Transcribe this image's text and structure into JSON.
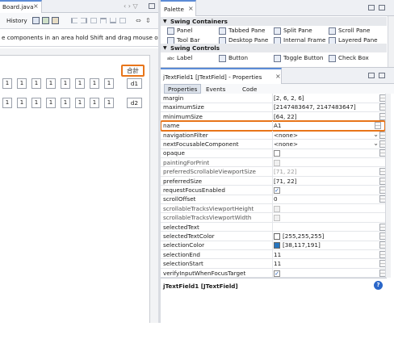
{
  "editor": {
    "tab_title": "Board.java",
    "tab_close": "×",
    "history_label": "History",
    "nav_arrows": "‹ › ▽",
    "hint_text": "e components in an area hold Shift and drag mouse over the",
    "sum_label": "合計",
    "row1_cells": [
      "1",
      "1",
      "1",
      "1",
      "1",
      "1",
      "1",
      "1"
    ],
    "row2_cells": [
      "1",
      "1",
      "1",
      "1",
      "1",
      "1",
      "1",
      "1"
    ],
    "row1_field": "d1",
    "row2_field": "d2"
  },
  "palette": {
    "title": "Palette",
    "close": "×",
    "groups": [
      {
        "name": "Swing Containers",
        "items": [
          "Panel",
          "Tabbed Pane",
          "Split Pane",
          "Scroll Pane",
          "Tool Bar",
          "Desktop Pane",
          "Internal Frame",
          "Layered Pane"
        ]
      },
      {
        "name": "Swing Controls",
        "items": [
          "Label",
          "Button",
          "Toggle Button",
          "Check Box"
        ]
      }
    ],
    "label_icon_text": "abc"
  },
  "properties": {
    "title": "jTextField1 [JTextField] - Properties",
    "close": "×",
    "tabs": [
      "Properties",
      "Events",
      "Code"
    ],
    "rows": [
      {
        "name": "margin",
        "value": "[2, 6, 2, 6]",
        "kind": "text",
        "dots": true
      },
      {
        "name": "maximumSize",
        "value": "[2147483647, 2147483647]",
        "kind": "text",
        "dots": true
      },
      {
        "name": "minimumSize",
        "value": "[64, 22]",
        "kind": "text",
        "dots": true
      },
      {
        "name": "name",
        "value": "A1",
        "kind": "text",
        "dots": true,
        "highlight": true
      },
      {
        "name": "navigationFilter",
        "value": "<none>",
        "kind": "dropdown",
        "dots": true
      },
      {
        "name": "nextFocusableComponent",
        "value": "<none>",
        "kind": "dropdown",
        "dots": true
      },
      {
        "name": "opaque",
        "value": "",
        "kind": "checkbox",
        "checked": false,
        "dots": true
      },
      {
        "name": "paintingForPrint",
        "value": "",
        "kind": "checkbox",
        "checked": false,
        "dim": true,
        "dots": false
      },
      {
        "name": "preferredScrollableViewportSize",
        "value": "[71, 22]",
        "kind": "text",
        "dim": true,
        "dots": true
      },
      {
        "name": "preferredSize",
        "value": "[71, 22]",
        "kind": "text",
        "dots": true
      },
      {
        "name": "requestFocusEnabled",
        "value": "",
        "kind": "checkbox",
        "checked": true,
        "dots": true
      },
      {
        "name": "scrollOffset",
        "value": "0",
        "kind": "text",
        "dots": true
      },
      {
        "name": "scrollableTracksViewportHeight",
        "value": "",
        "kind": "checkbox",
        "checked": false,
        "dim": true,
        "dots": false
      },
      {
        "name": "scrollableTracksViewportWidth",
        "value": "",
        "kind": "checkbox",
        "checked": false,
        "dim": true,
        "dots": false
      },
      {
        "name": "selectedText",
        "value": "",
        "kind": "text",
        "dots": true
      },
      {
        "name": "selectedTextColor",
        "value": "[255,255,255]",
        "kind": "color",
        "color": "#ffffff",
        "dots": true
      },
      {
        "name": "selectionColor",
        "value": "[38,117,191]",
        "kind": "color",
        "color": "#2675bf",
        "dots": true
      },
      {
        "name": "selectionEnd",
        "value": "11",
        "kind": "text",
        "dots": true
      },
      {
        "name": "selectionStart",
        "value": "11",
        "kind": "text",
        "dots": true
      },
      {
        "name": "verifyInputWhenFocusTarget",
        "value": "",
        "kind": "checkbox",
        "checked": true,
        "dots": true
      }
    ],
    "footer": "jTextField1 [JTextField]",
    "help_icon": "?"
  },
  "colors": {
    "highlight": "#e8751a",
    "accent": "#2675bf",
    "header_bg": "#eef0f4"
  }
}
